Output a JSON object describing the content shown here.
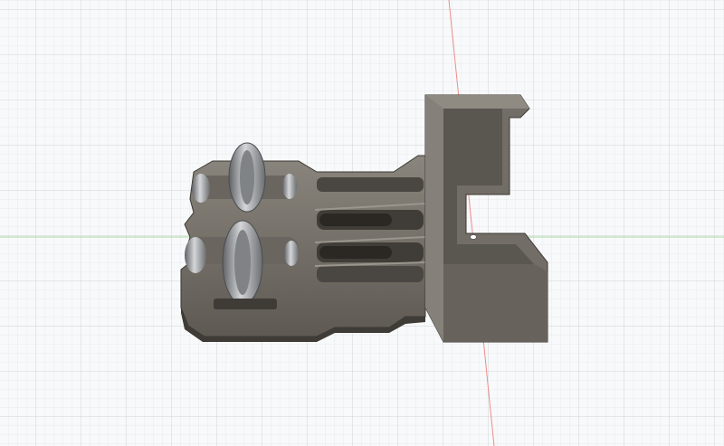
{
  "canvas": {
    "background": "#f8f9fa",
    "grid_minor_color": "#e3e6e9",
    "grid_major_color": "#cfd3d7",
    "x_axis_color": "#a8dca0",
    "y_axis_color": "#f08c8c"
  },
  "model": {
    "material_base": "#6f6a63",
    "material_dark": "#3f3b36",
    "material_light": "#8c877f",
    "metal_color": "#9a9da0",
    "origin_marker": "origin-point-icon"
  }
}
